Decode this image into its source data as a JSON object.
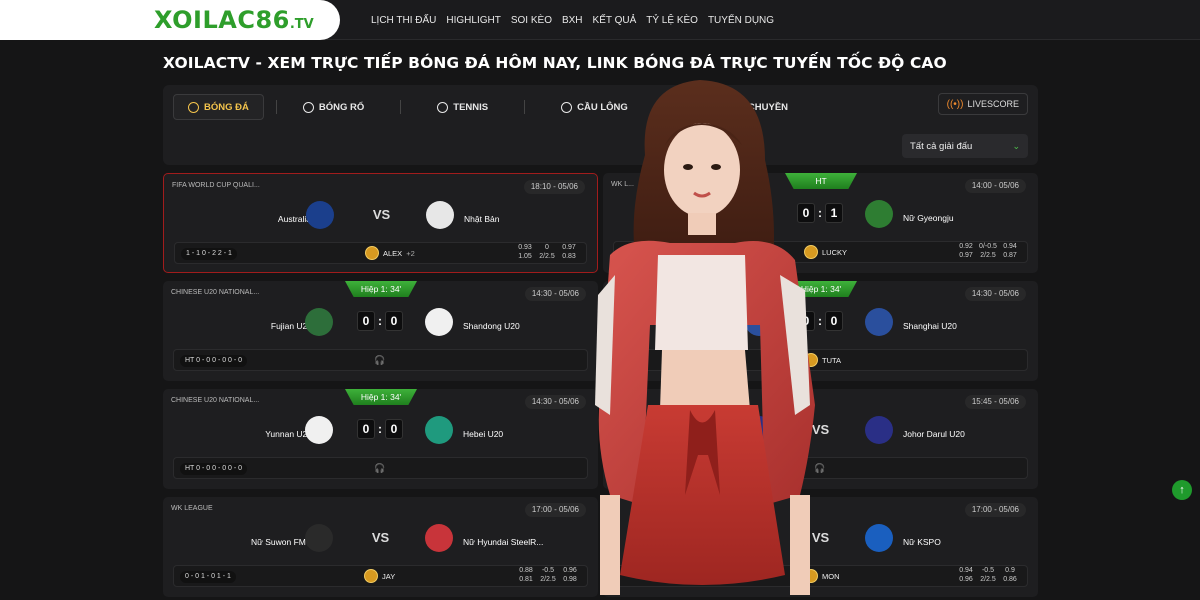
{
  "header": {
    "logo_main": "XOILAC86",
    "logo_suffix": ".TV",
    "nav": [
      "LỊCH THI ĐẤU",
      "HIGHLIGHT",
      "SOI KÈO",
      "BXH",
      "KẾT QUẢ",
      "TỶ LỆ KÈO",
      "TUYỂN DỤNG"
    ]
  },
  "headline": "XOILACTV - XEM TRỰC TIẾP BÓNG ĐÁ HÔM NAY, LINK BÓNG ĐÁ TRỰC TUYẾN TỐC ĐỘ CAO",
  "tabs": [
    "BÓNG ĐÁ",
    "BÓNG RỔ",
    "TENNIS",
    "CẦU LÔNG",
    "BÓNG CHUYỀN"
  ],
  "livescore": "LIVESCORE",
  "league_select": "Tất cả giải đấu",
  "cards": [
    {
      "league": "FIFA WORLD CUP QUALI...",
      "time": "18:10 - 05/06",
      "status": "",
      "home": "Australia",
      "away": "Nhật Bản",
      "score": null,
      "stats": "1 - 1   0 - 2   2 - 1",
      "commentator": "ALEX",
      "extra": "+2",
      "odds": [
        "0.93",
        "0",
        "0.97",
        "1.05",
        "2/2.5",
        "0.83"
      ]
    },
    {
      "league": "WK L...",
      "time": "14:00 - 05/06",
      "status": "HT",
      "home": "",
      "away": "Nữ Gyeongju",
      "score": [
        "0",
        "1"
      ],
      "stats": "",
      "commentator": "LUCKY",
      "extra": "",
      "odds": [
        "0.92",
        "0/-0.5",
        "0.94",
        "0.97",
        "2/2.5",
        "0.87"
      ]
    },
    {
      "league": "CHINESE U20 NATIONAL...",
      "time": "14:30 - 05/06",
      "status": "Hiệp 1: 34'",
      "home": "Fujian U20",
      "away": "Shandong U20",
      "score": [
        "0",
        "0"
      ],
      "stats": "HT 0 - 0   0 - 0   0 - 0",
      "commentator": "",
      "extra": "",
      "odds": []
    },
    {
      "league": "",
      "time": "14:30 - 05/06",
      "status": "Hiệp 1: 34'",
      "home": "",
      "away": "Shanghai U20",
      "score": [
        "0",
        "0"
      ],
      "stats": "",
      "commentator": "TUTA",
      "extra": "",
      "odds": []
    },
    {
      "league": "CHINESE U20 NATIONAL...",
      "time": "14:30 - 05/06",
      "status": "Hiệp 1: 34'",
      "home": "Yunnan U20",
      "away": "Hebei U20",
      "score": [
        "0",
        "0"
      ],
      "stats": "HT 0 - 0   0 - 0   0 - 0",
      "commentator": "",
      "extra": "",
      "odds": []
    },
    {
      "league": "",
      "time": "15:45 - 05/06",
      "status": "",
      "home": "",
      "away": "Johor Darul U20",
      "score": null,
      "stats": "",
      "commentator": "",
      "extra": "",
      "odds": []
    },
    {
      "league": "WK LEAGUE",
      "time": "17:00 - 05/06",
      "status": "",
      "home": "Nữ Suwon FMC",
      "away": "Nữ Hyundai SteelR...",
      "score": null,
      "stats": "0 - 0   1 - 0   1 - 1",
      "commentator": "JAY",
      "extra": "",
      "odds": [
        "0.88",
        "-0.5",
        "0.96",
        "0.81",
        "2/2.5",
        "0.98"
      ]
    },
    {
      "league": "",
      "time": "17:00 - 05/06",
      "status": "",
      "home": "",
      "away": "Nữ KSPO",
      "score": null,
      "stats": "",
      "commentator": "MON",
      "extra": "",
      "odds": [
        "0.94",
        "-0.5",
        "0.9",
        "0.96",
        "2/2.5",
        "0.86"
      ]
    }
  ],
  "colors": {
    "accent": "#2e9e2b",
    "highlight": "#a11c1c",
    "gold": "#f4c44c"
  }
}
